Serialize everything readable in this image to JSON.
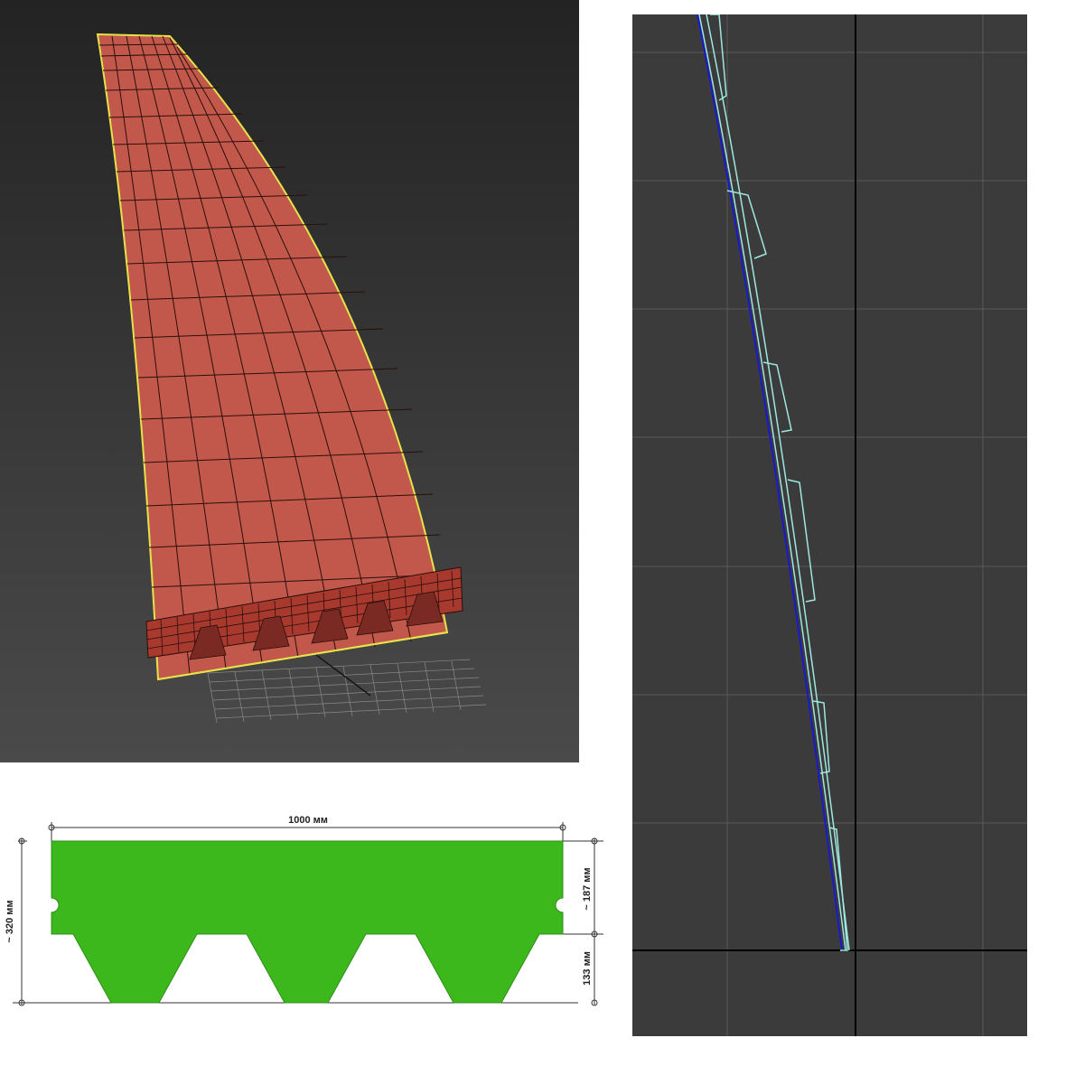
{
  "viewport_perspective": {
    "label": "Perspective viewport",
    "mesh_color": "#c2584c",
    "wire_color": "#2a0f0a",
    "selection_color": "#e6e34a",
    "bg_top": "#232323",
    "bg_bottom": "#4a4a4a"
  },
  "viewport_side": {
    "label": "Side viewport",
    "bg": "#3b3b3b",
    "grid_color": "#5a5a5a",
    "axis_color": "#000000",
    "profile_color": "#9ee8e0",
    "spline_color": "#1a1acc"
  },
  "shingle": {
    "fill": "#3cb81c",
    "width_label": "1000 мм",
    "height_label": "~ 320 мм",
    "upper_label": "~ 187 мм",
    "tab_label": "133 мм"
  }
}
